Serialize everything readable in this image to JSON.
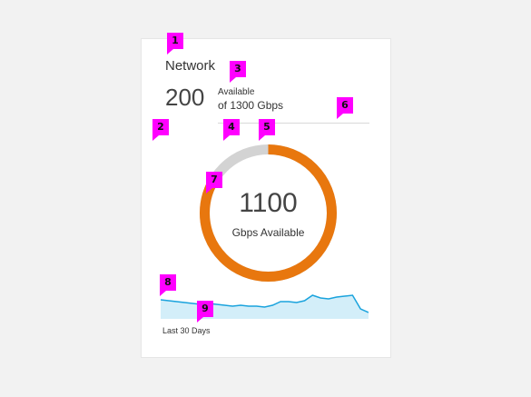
{
  "widget": {
    "title": "Network",
    "available_value": "200",
    "available_label": "Available",
    "available_of": "of 1300 Gbps",
    "donut_value": "1100",
    "donut_unit": "Gbps Available",
    "period_label": "Last 30 Days"
  },
  "donut": {
    "used_fraction": 0.8462,
    "colors": {
      "used": "#e8770e",
      "remaining": "#d3d3d3"
    }
  },
  "sparkline": {
    "values": [
      21,
      20,
      19,
      18,
      17,
      16,
      17,
      16,
      15,
      14,
      15,
      14,
      14,
      13,
      15,
      19,
      19,
      18,
      20,
      26,
      23,
      22,
      24,
      25,
      26,
      11,
      7
    ],
    "colors": {
      "line": "#1aa3dd",
      "fill": "#d3eef9"
    }
  },
  "badges": [
    "1",
    "2",
    "3",
    "4",
    "5",
    "6",
    "7",
    "8",
    "9"
  ]
}
